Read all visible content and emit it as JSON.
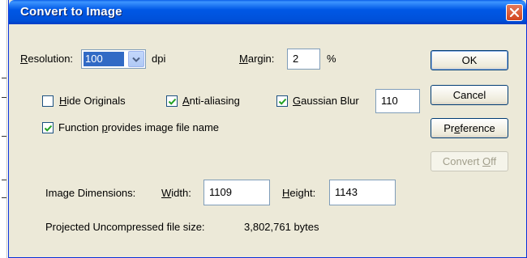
{
  "window": {
    "title": "Convert to Image"
  },
  "resolution": {
    "label_hotkey": "R",
    "label_rest": "esolution:",
    "value": "100",
    "unit": "dpi"
  },
  "margin": {
    "label_hotkey": "M",
    "label_rest": "argin:",
    "value": "2",
    "unit": "%"
  },
  "options": {
    "hide_originals": {
      "hotkey": "H",
      "rest": "ide Originals",
      "checked": false
    },
    "anti_aliasing": {
      "hotkey": "A",
      "rest": "nti-aliasing",
      "checked": true
    },
    "gaussian_blur": {
      "hotkey": "G",
      "rest": "aussian Blur",
      "checked": true,
      "value": "110"
    },
    "function_filename": {
      "before": "Function ",
      "hotkey": "p",
      "after": "rovides image file name",
      "checked": true
    }
  },
  "buttons": {
    "ok": "OK",
    "cancel": "Cancel",
    "preference_pre": "Pr",
    "preference_hotkey": "e",
    "preference_post": "ference",
    "convert_off_pre": "Convert ",
    "convert_off_hotkey": "O",
    "convert_off_post": "ff"
  },
  "dimensions": {
    "label": "Image Dimensions:",
    "width_hotkey": "W",
    "width_rest": "idth:",
    "width_value": "1109",
    "height_hotkey": "H",
    "height_rest": "eight:",
    "height_value": "1143"
  },
  "filesize": {
    "label": "Projected Uncompressed file size:",
    "value": "3,802,761 bytes"
  },
  "colors": {
    "titlebar": "#0058e6",
    "dialog_bg": "#ece9d8",
    "close_button": "#d2451f",
    "selection": "#316ac5",
    "checkmark": "#21a121"
  }
}
